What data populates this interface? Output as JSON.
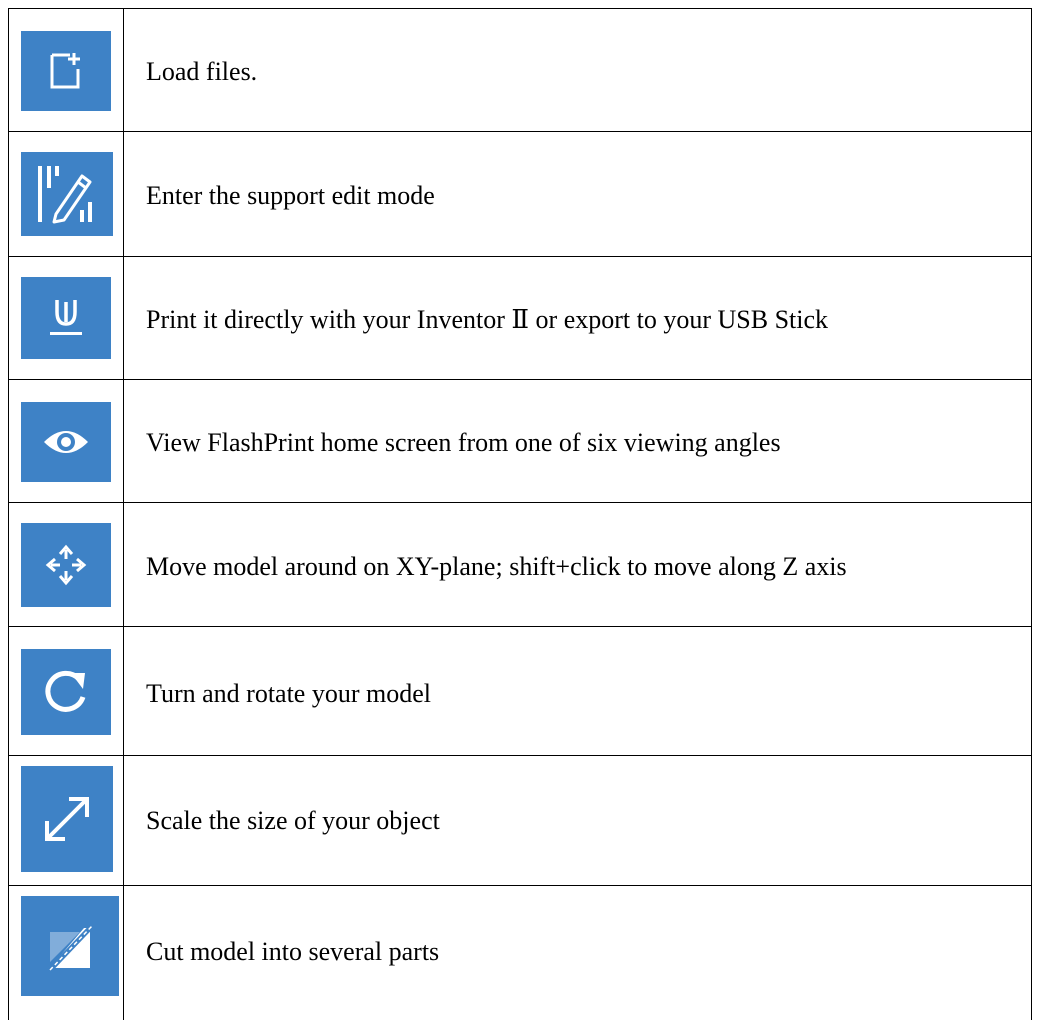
{
  "colors": {
    "icon_background": "#3e82c6",
    "icon_foreground": "#ffffff",
    "border": "#000000"
  },
  "rows": [
    {
      "icon": "load-file-icon",
      "text": "Load files."
    },
    {
      "icon": "support-edit-icon",
      "text": "Enter the support edit mode"
    },
    {
      "icon": "print-icon",
      "text": "Print it directly with your Inventor Ⅱ or export to your USB Stick"
    },
    {
      "icon": "view-eye-icon",
      "text": "View FlashPrint home screen from one of six viewing angles"
    },
    {
      "icon": "move-icon",
      "text": "Move model around on XY-plane; shift+click to move along Z axis"
    },
    {
      "icon": "rotate-icon",
      "text": "Turn and rotate your model"
    },
    {
      "icon": "scale-icon",
      "text": "Scale the size of your object"
    },
    {
      "icon": "cut-icon",
      "text": "Cut model into several parts"
    }
  ]
}
